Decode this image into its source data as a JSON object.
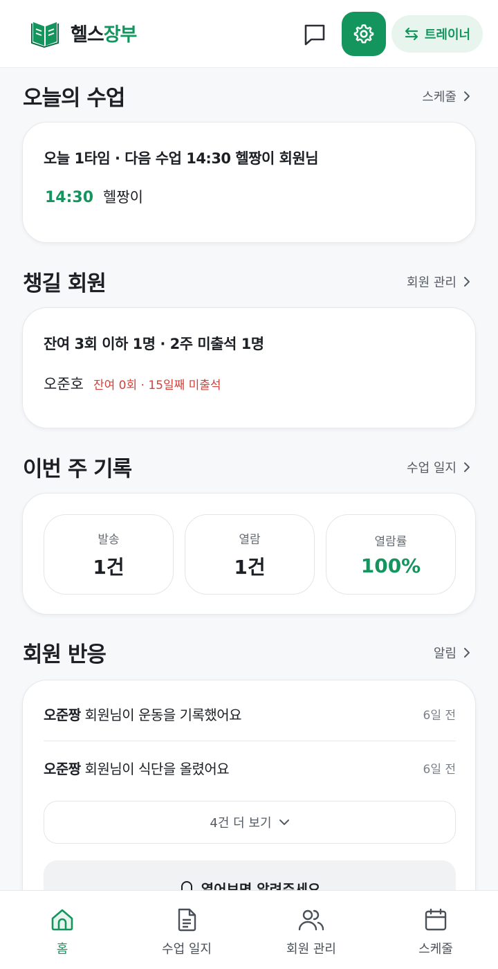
{
  "app": {
    "logo_part1": "헬스",
    "logo_part2": "장부",
    "trainer_label": "트레이너"
  },
  "today_class": {
    "title": "오늘의 수업",
    "link": "스케줄",
    "summary": "오늘 1타임 · 다음 수업 14:30 헬짱이 회원님",
    "time": "14:30",
    "member": "헬짱이"
  },
  "care_members": {
    "title": "챙길 회원",
    "link": "회원 관리",
    "summary": "잔여 3회 이하 1명 · 2주 미출석 1명",
    "member": "오준호",
    "warning": "잔여 0회 · 15일째 미출석"
  },
  "weekly": {
    "title": "이번 주 기록",
    "link": "수업 일지",
    "stats": [
      {
        "label": "발송",
        "value": "1건"
      },
      {
        "label": "열람",
        "value": "1건"
      },
      {
        "label": "열람률",
        "value": "100%"
      }
    ]
  },
  "reactions": {
    "title": "회원 반응",
    "link": "알림",
    "items": [
      {
        "name": "오준짱",
        "text": " 회원님이 운동을 기록했어요",
        "ago": "6일 전"
      },
      {
        "name": "오준짱",
        "text": " 회원님이 식단을 올렸어요",
        "ago": "6일 전"
      }
    ],
    "more_label": "4건 더 보기",
    "notify_label": "열어보면 알려주세요"
  },
  "nav": {
    "items": [
      {
        "label": "홈",
        "icon": "home-icon"
      },
      {
        "label": "수업 일지",
        "icon": "document-icon"
      },
      {
        "label": "회원 관리",
        "icon": "users-icon"
      },
      {
        "label": "스케줄",
        "icon": "calendar-icon"
      }
    ]
  },
  "colors": {
    "accent": "#14955e",
    "warning": "#d0423b"
  }
}
